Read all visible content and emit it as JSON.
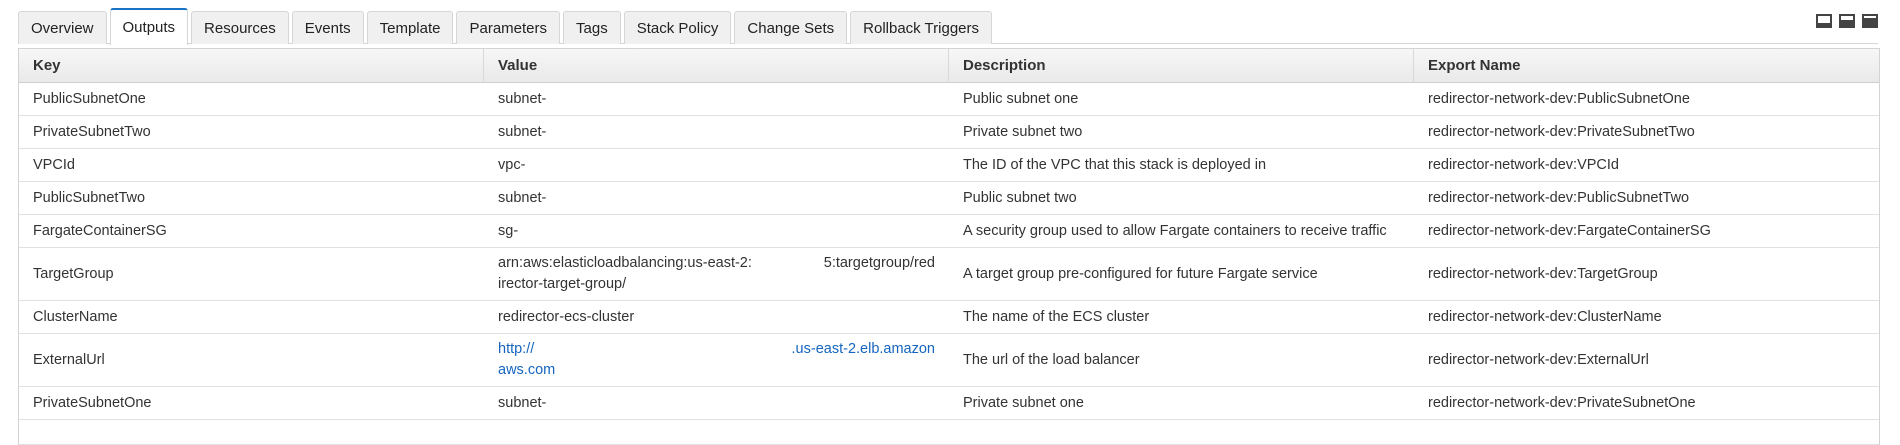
{
  "tabs": [
    {
      "label": "Overview",
      "active": false
    },
    {
      "label": "Outputs",
      "active": true
    },
    {
      "label": "Resources",
      "active": false
    },
    {
      "label": "Events",
      "active": false
    },
    {
      "label": "Template",
      "active": false
    },
    {
      "label": "Parameters",
      "active": false
    },
    {
      "label": "Tags",
      "active": false
    },
    {
      "label": "Stack Policy",
      "active": false
    },
    {
      "label": "Change Sets",
      "active": false
    },
    {
      "label": "Rollback Triggers",
      "active": false
    }
  ],
  "view_icons": [
    "panel-bottom-small-icon",
    "panel-bottom-half-icon",
    "panel-maximize-icon"
  ],
  "columns": {
    "key": "Key",
    "value": "Value",
    "description": "Description",
    "export_name": "Export Name"
  },
  "rows": [
    {
      "key": "PublicSubnetOne",
      "value": "subnet-",
      "description": "Public subnet one",
      "export_name": "redirector-network-dev:PublicSubnetOne"
    },
    {
      "key": "PrivateSubnetTwo",
      "value": "subnet-",
      "description": "Private subnet two",
      "export_name": "redirector-network-dev:PrivateSubnetTwo"
    },
    {
      "key": "VPCId",
      "value": "vpc-",
      "description": "The ID of the VPC that this stack is deployed in",
      "export_name": "redirector-network-dev:VPCId"
    },
    {
      "key": "PublicSubnetTwo",
      "value": "subnet-",
      "description": "Public subnet two",
      "export_name": "redirector-network-dev:PublicSubnetTwo"
    },
    {
      "key": "FargateContainerSG",
      "value": "sg-",
      "description": "A security group used to allow Fargate containers to receive traffic",
      "export_name": "redirector-network-dev:FargateContainerSG"
    },
    {
      "key": "TargetGroup",
      "value_line1": "arn:aws:elasticloadbalancing:us-east-2:",
      "value_line1_tail": "5:targetgroup/red",
      "value_line2": "irector-target-group/",
      "description": "A target group pre-configured for future Fargate service",
      "export_name": "redirector-network-dev:TargetGroup"
    },
    {
      "key": "ClusterName",
      "value": "redirector-ecs-cluster",
      "description": "The name of the ECS cluster",
      "export_name": "redirector-network-dev:ClusterName"
    },
    {
      "key": "ExternalUrl",
      "value_line1": "http://",
      "value_line1_tail": ".us-east-2.elb.amazon",
      "value_line2": "aws.com",
      "description": "The url of the load balancer",
      "export_name": "redirector-network-dev:ExternalUrl"
    },
    {
      "key": "PrivateSubnetOne",
      "value": "subnet-",
      "description": "Private subnet one",
      "export_name": "redirector-network-dev:PrivateSubnetOne"
    }
  ]
}
